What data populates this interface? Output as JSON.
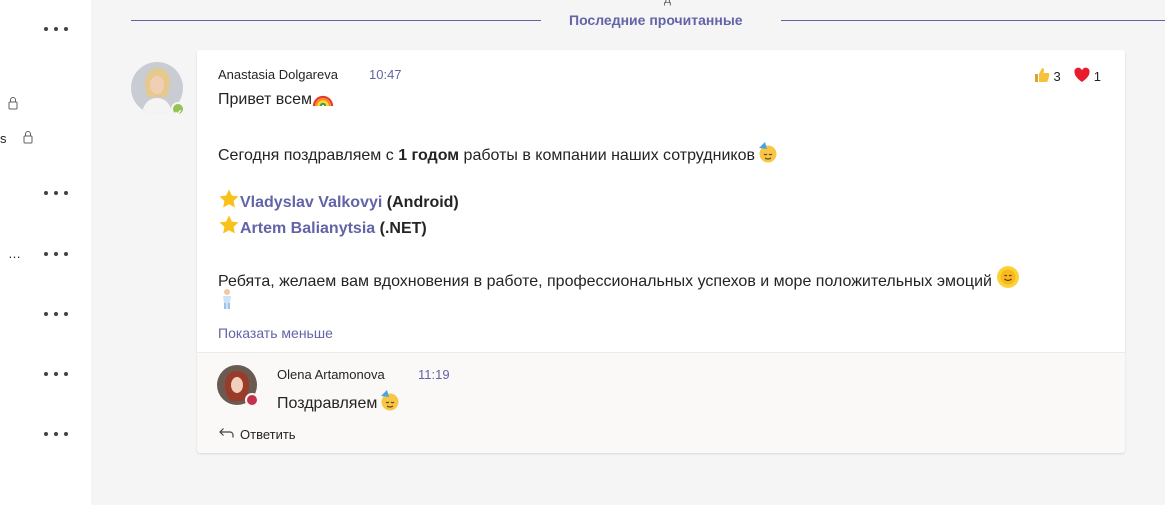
{
  "sidebar": {
    "truncated_1": "s",
    "truncated_2": "…"
  },
  "main": {
    "top_fragment": "д",
    "divider_label": "Последние прочитанные"
  },
  "post": {
    "author": "Anastasia Dolgareva",
    "time": "10:47",
    "reactions": [
      {
        "icon": "thumbs-up-icon",
        "count": "3"
      },
      {
        "icon": "heart-icon",
        "count": "1"
      }
    ],
    "greeting": "Привет всем",
    "congrats_before": "Сегодня поздравляем с ",
    "congrats_bold": "1 годом",
    "congrats_after": " работы в компании наших сотрудников",
    "employees": [
      {
        "name": "Vladyslav Valkovyi",
        "role": "(Android)"
      },
      {
        "name": "Artem Balianytsia",
        "role": "(.NET)"
      }
    ],
    "wish": "Ребята, желаем вам вдохновения в работе,  профессиональных успехов и море положительных эмоций",
    "show_less": "Показать меньше"
  },
  "reply": {
    "author": "Olena Artamonova",
    "time": "11:19",
    "text": "Поздравляем",
    "reply_label": "Ответить"
  },
  "colors": {
    "accent": "#6264a7",
    "available": "#92c353",
    "busy": "#c4314b",
    "background": "#f5f5f5"
  }
}
